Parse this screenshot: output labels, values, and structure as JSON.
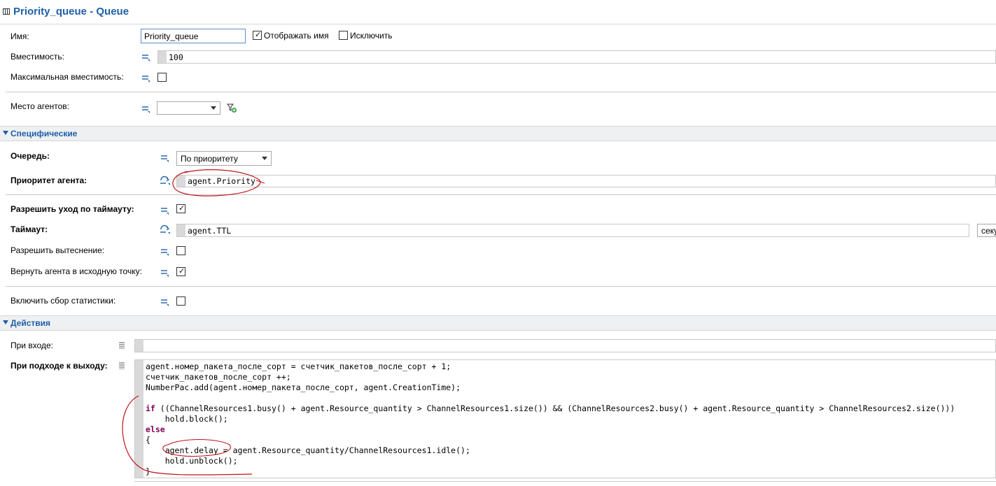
{
  "title": "Priority_queue - Queue",
  "props": {
    "name_label": "Имя:",
    "name_value": "Priority_queue",
    "show_name_label": "Отображать имя",
    "exclude_label": "Исключить",
    "capacity_label": "Вместимость:",
    "capacity_value": "100",
    "max_capacity_label": "Максимальная вместимость:",
    "agent_location_label": "Место агентов:"
  },
  "specific": {
    "section_title": "Специфические",
    "queue_label": "Очередь:",
    "queue_value": "По приоритету",
    "priority_label": "Приоритет агента:",
    "priority_value": "agent.Priority",
    "timeout_allow_label": "Разрешить уход по таймауту:",
    "timeout_label": "Таймаут:",
    "timeout_value": "agent.TTL",
    "timeout_unit": "секу",
    "preemption_label": "Разрешить вытеснение:",
    "return_label": "Вернуть агента в исходную точку:",
    "stats_label": "Включить сбор статистики:"
  },
  "actions": {
    "section_title": "Действия",
    "on_enter_label": "При входе:",
    "on_exit_label": "При подходе к выходу:",
    "code": [
      "agent.номер_пакета_после_сорт = счетчик_пакетов_после_сорт + 1;",
      "счетчик_пакетов_после_сорт ++;",
      "NumberPac.add(agent.номер_пакета_после_сорт, agent.CreationTime);",
      "",
      "((ChannelResources1.busy() + agent.Resource_quantity > ChannelResources1.size()) && (ChannelResources2.busy() + agent.Resource_quantity > ChannelResources2.size()))",
      "    hold.block();",
      "",
      "{",
      "    agent.delay = agent.Resource_quantity/ChannelResources1.idle();",
      "    hold.unblock();",
      "}"
    ],
    "kw_if": "if",
    "kw_else": "else"
  },
  "colors": {
    "accent": "#1e5fa6",
    "annotation": "#c0151b",
    "keyword": "#7f0055"
  }
}
